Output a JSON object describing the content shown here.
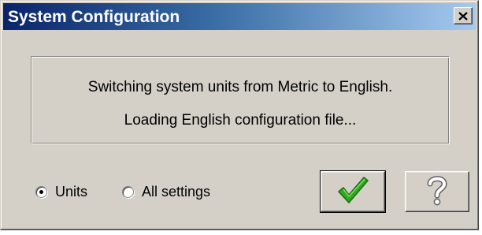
{
  "window": {
    "title": "System Configuration",
    "close_icon": "close-icon"
  },
  "message": {
    "line1": "Switching system units from Metric to English.",
    "line2": "Loading English configuration file..."
  },
  "scope_options": [
    {
      "label": "Units",
      "selected": true
    },
    {
      "label": "All settings",
      "selected": false
    }
  ],
  "buttons": {
    "ok_icon": "checkmark-icon",
    "help_icon": "question-mark-icon"
  },
  "colors": {
    "titlebar_start": "#0a246a",
    "titlebar_end": "#a6caf0",
    "face": "#d4d0c8",
    "checkmark": "#2faa1c"
  }
}
